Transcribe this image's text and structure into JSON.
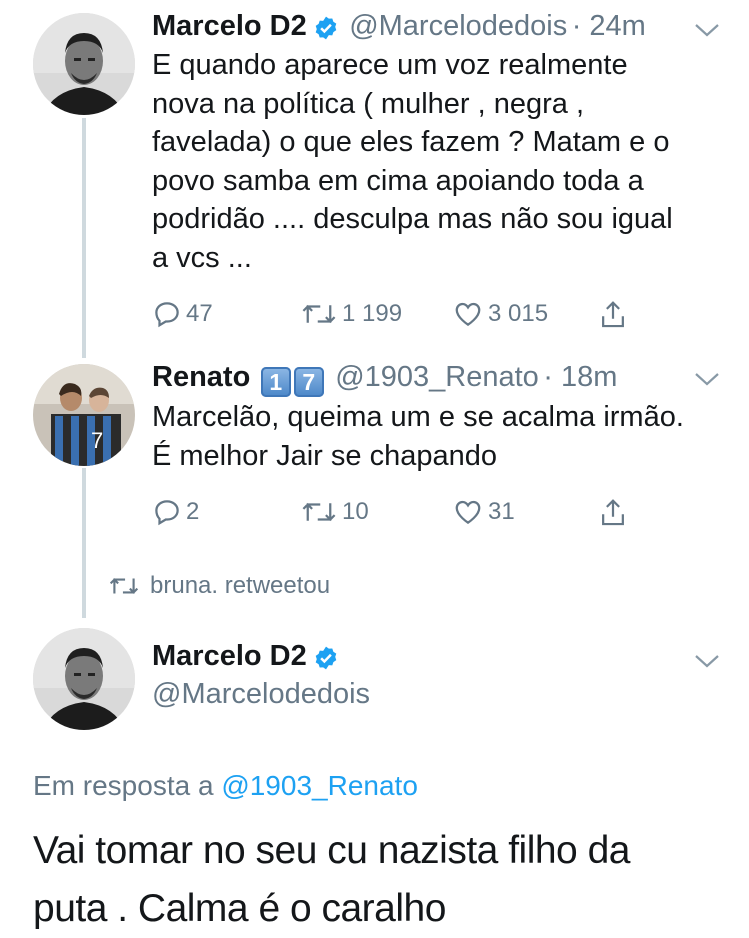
{
  "colors": {
    "text": "#14171a",
    "muted": "#657786",
    "link": "#1da1f2",
    "thread": "#cfd9de"
  },
  "tweet1": {
    "name": "Marcelo D2",
    "handle": "@Marcelodedois",
    "time": "· 24m",
    "lines": [
      "E quando aparece um voz realmente",
      "nova na política ( mulher , negra ,",
      "favelada) o que eles fazem ? Matam e o",
      "povo samba em cima apoiando toda a",
      "podridão .... desculpa mas não sou  igual",
      "a vcs ..."
    ],
    "replies": "47",
    "retweets": "1 199",
    "likes": "3 015"
  },
  "tweet2": {
    "name": "Renato",
    "badge1": "1",
    "badge2": "7",
    "handle": "@1903_Renato",
    "time": "· 18m",
    "lines": [
      "Marcelão, queima um e se acalma irmão.",
      "É melhor Jair se chapando"
    ],
    "replies": "2",
    "retweets": "10",
    "likes": "31"
  },
  "retweet_context": "bruna. retweetou",
  "tweet3": {
    "name": "Marcelo D2",
    "handle": "@Marcelodedois",
    "reply_prefix": "Em resposta a",
    "reply_to": "@1903_Renato",
    "lines": [
      "Vai tomar no seu cu nazista filho da",
      "puta . Calma é o caralho"
    ]
  }
}
